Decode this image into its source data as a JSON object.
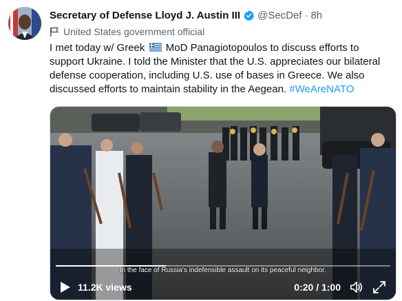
{
  "author": {
    "name": "Secretary of Defense Lloyd J. Austin III",
    "handle": "@SecDef",
    "separator": "·",
    "time": "8h",
    "label": "United States government official",
    "verified_color": "#1d9bf0"
  },
  "tweet": {
    "text_part1": "I met today w/ Greek ",
    "flag_icon": "greece-flag-icon",
    "text_part2": " MoD Panagiotopoulos to discuss efforts to support Ukraine. I told the Minister that the U.S. appreciates our bilateral defense cooperation, including U.S. use of bases in Greece. We also discussed efforts to maintain stability in the Aegean. ",
    "hashtag": "#WeAreNATO"
  },
  "video": {
    "caption": "in the face of Russia's indefensible assault on its peaceful neighbor.",
    "views": "11.2K views",
    "timer": "0:20 / 1:00",
    "progress": 0.33
  },
  "icons": {
    "play": "play-icon",
    "volume": "volume-icon",
    "fullscreen": "fullscreen-icon",
    "label": "flag-label-icon"
  }
}
